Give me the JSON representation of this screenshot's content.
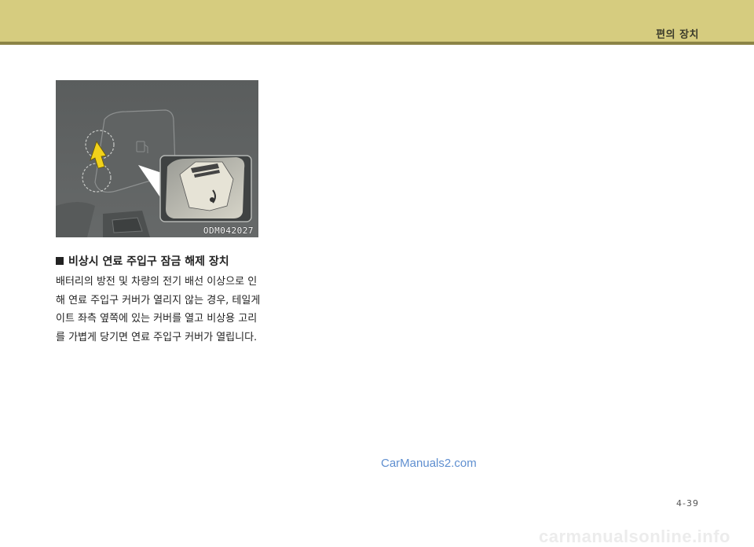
{
  "header": {
    "section_title": "편의 장치",
    "band_color": "#d6cc7f",
    "rule_color": "#8c8446"
  },
  "figure": {
    "code": "ODM042027"
  },
  "content": {
    "heading": "비상시 연료 주입구 잠금 해제 장치",
    "lines": [
      "배터리의 방전 및 차량의 전기 배선 이상으로 인",
      "해 연료 주입구 커버가 열리지 않는 경우, 테일게",
      "이트 좌측 옆쪽에 있는 커버를 열고 비상용 고리",
      "를 가볍게 당기면 연료 주입구 커버가 열립니다."
    ]
  },
  "watermark": "CarManuals2.com",
  "page_number": "4-39",
  "footer_watermark": "carmanualsonline.info"
}
